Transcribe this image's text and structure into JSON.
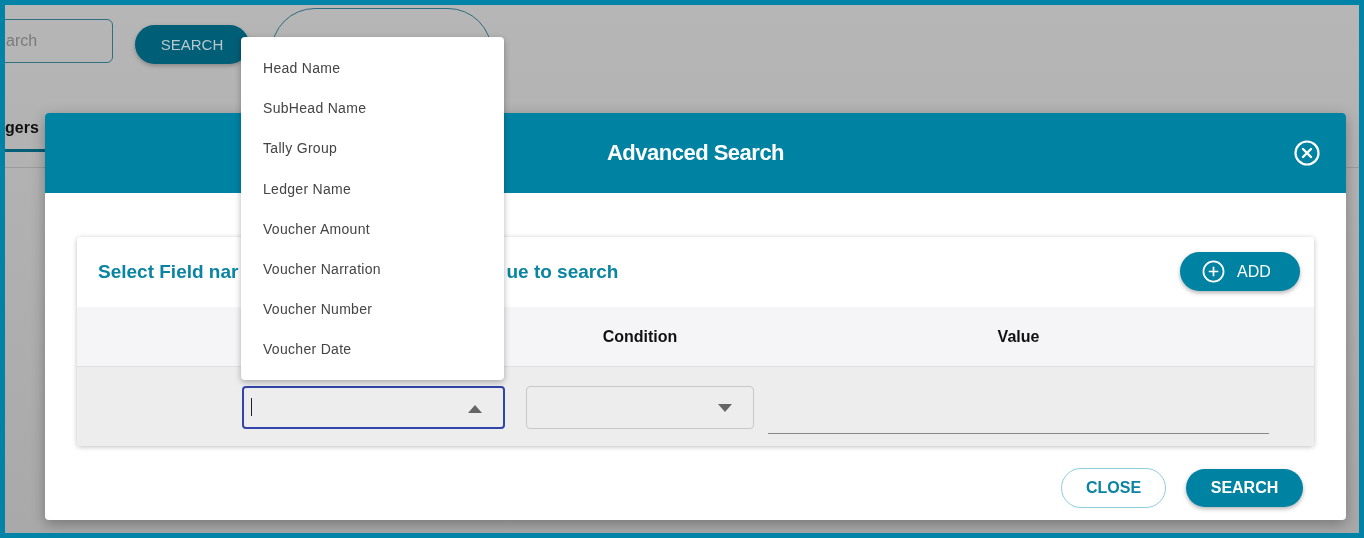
{
  "background": {
    "search_field": {
      "placeholder": "arch"
    },
    "search_button": "SEARCH",
    "tab": {
      "label": "gers",
      "selected": true
    }
  },
  "dialog": {
    "title": "Advanced Search",
    "card_title": [
      "Select Field nar",
      "ue to search"
    ],
    "add_button": "ADD",
    "columns": [
      {
        "label": "Condition"
      },
      {
        "label": "Value"
      }
    ],
    "row": {
      "field_select": {
        "focused": true,
        "expanded": true
      }
    },
    "buttons": [
      {
        "kind": "outline",
        "label": "CLOSE"
      },
      {
        "kind": "filled",
        "label": "SEARCH"
      }
    ]
  },
  "field_options": [
    "Head Name",
    "SubHead Name",
    "Tally Group",
    "Ledger Name",
    "Voucher Amount",
    "Voucher Narration",
    "Voucher Number",
    "Voucher Date"
  ]
}
